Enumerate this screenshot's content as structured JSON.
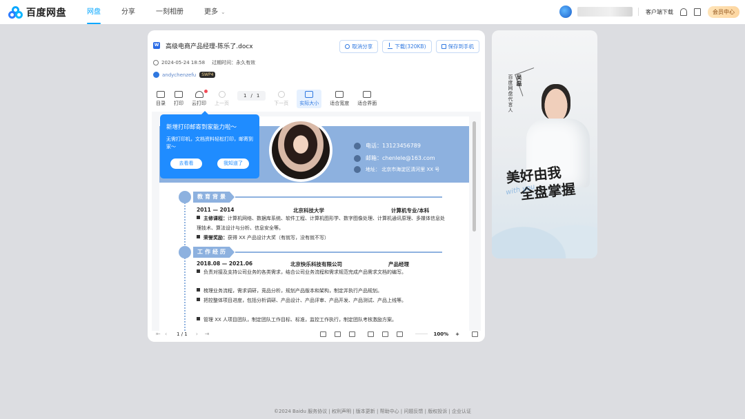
{
  "header": {
    "brand": "百度网盘",
    "nav": [
      {
        "label": "网盘",
        "active": true
      },
      {
        "label": "分享",
        "active": false
      },
      {
        "label": "一刻相册",
        "active": false
      },
      {
        "label": "更多",
        "active": false
      }
    ],
    "client_download": "客户端下载",
    "vip_label": "会员中心",
    "accent_color": "#06a7ff"
  },
  "file": {
    "name": "高级电商产品经理-陈乐了.docx",
    "date": "2024-05-24 18:58",
    "expire": "过期时间：永久有效",
    "owner": "andychenzefu",
    "owner_badge": "SWP4",
    "actions": {
      "cancel_share": "取消分享",
      "download": "下载(320KB)",
      "save_phone": "保存到手机"
    }
  },
  "toolbar": {
    "catalog": "目录",
    "print": "打印",
    "cloud_print": "云打印",
    "prev": "上一页",
    "page_current": "1",
    "page_sep": "/",
    "page_total": "1",
    "next": "下一页",
    "actual_size": "实际大小",
    "fit_width": "适合宽度",
    "fit_page": "适合界面"
  },
  "tooltip": {
    "title": "新增打印邮寄到家能力啦～",
    "text": "无需打印机，文档资料轻松打印，邮寄到家～",
    "btn_view": "去看看",
    "btn_ok": "我知道了"
  },
  "resume": {
    "phone": "电话：13123456789",
    "email": "邮箱：chenlele@163.com",
    "address": "地址： 北京市海淀区清河里 XX 号",
    "edu": {
      "title": "教育背景",
      "period": "2011 — 2014",
      "school": "北京科技大学",
      "major": "计算机专业/本科",
      "courses_label": "主修课程：",
      "courses": "计算机网络、数据库系统、软件工程、计算机图形学、数字图像处理、计算机通讯原理、多媒体信息处理技术、算法设计与分析、信息安全等。",
      "awards_label": "荣誉奖励：",
      "awards": "获得 XX 产品设计大奖（有就写，没有就不写）"
    },
    "work": {
      "title": "工作经历",
      "period": "2018.08 — 2021.06",
      "company": "北京快乐科技有限公司",
      "role": "产品经理",
      "items": [
        "负责对接及支持公司业务的各类需求，结合公司业务流程和需求规范完成产品需求文档的编写。",
        "梳理业务流程，需求调研，竞品分析，规划产品版本和架构，制定并执行产品规划。",
        "把控整体项目进度，包括分析调研、产品设计、产品评审、产品开发、产品测试、产品上线等。",
        "管理 XX 人项目团队，制定团队工作目标、标准，监控工作执行，制定团队考核激励方案。"
      ]
    }
  },
  "bottombar": {
    "page_current": "1",
    "page_sep": "/",
    "page_total": "1",
    "zoom": "100%",
    "zoom_in": "+"
  },
  "ad": {
    "line1": "百度网盘代言人",
    "name": "吴磊",
    "slogan1": "美好由我",
    "slogan2": "全盘掌握",
    "script": "with you"
  },
  "footer": "©2024 Baidu  服务协议 | 权利声明 | 版本更新 | 帮助中心 | 问题反馈 | 版权投诉 | 企业认证"
}
